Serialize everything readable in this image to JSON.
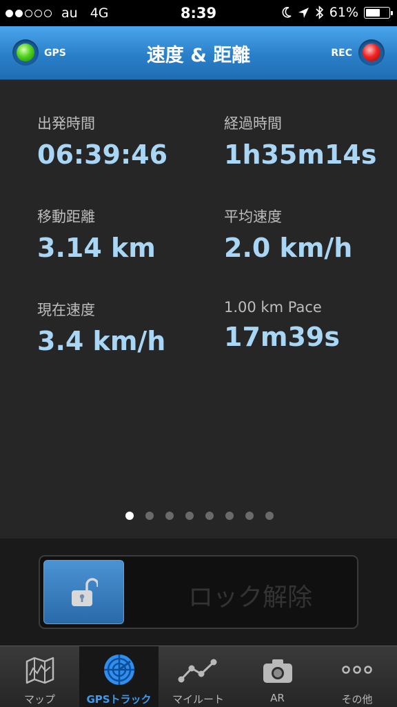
{
  "status_bar": {
    "carrier": "au",
    "network": "4G",
    "time": "8:39",
    "battery": "61%",
    "battery_level": 0.61,
    "signal_bars": 2,
    "icons": [
      "moon-icon",
      "location-arrow-icon",
      "bluetooth-icon",
      "battery-icon"
    ]
  },
  "header": {
    "title": "速度 & 距離",
    "gps_label": "GPS",
    "rec_label": "REC",
    "gps_color": "#4fd21c",
    "rec_color": "#f22424"
  },
  "stats": [
    {
      "label": "出発時間",
      "value": "06:39:46"
    },
    {
      "label": "経過時間",
      "value": "1h35m14s"
    },
    {
      "label": "移動距離",
      "value": "3.14 km"
    },
    {
      "label": "平均速度",
      "value": "2.0 km/h"
    },
    {
      "label": "現在速度",
      "value": "3.4 km/h"
    },
    {
      "label": "1.00 km Pace",
      "value": "17m39s"
    }
  ],
  "pager": {
    "pages": 8,
    "current": 1
  },
  "lock": {
    "label": "ロック解除",
    "icon": "unlock-icon"
  },
  "tabs": [
    {
      "label": "マップ",
      "icon": "map-icon"
    },
    {
      "label": "GPSトラック",
      "icon": "radar-icon",
      "active": true
    },
    {
      "label": "マイルート",
      "icon": "route-icon"
    },
    {
      "label": "AR",
      "icon": "camera-icon"
    },
    {
      "label": "その他",
      "icon": "more-icon"
    }
  ],
  "colors": {
    "accent": "#3d9bef",
    "value_text": "#a8d6f4",
    "header": "#2a7fc9"
  }
}
